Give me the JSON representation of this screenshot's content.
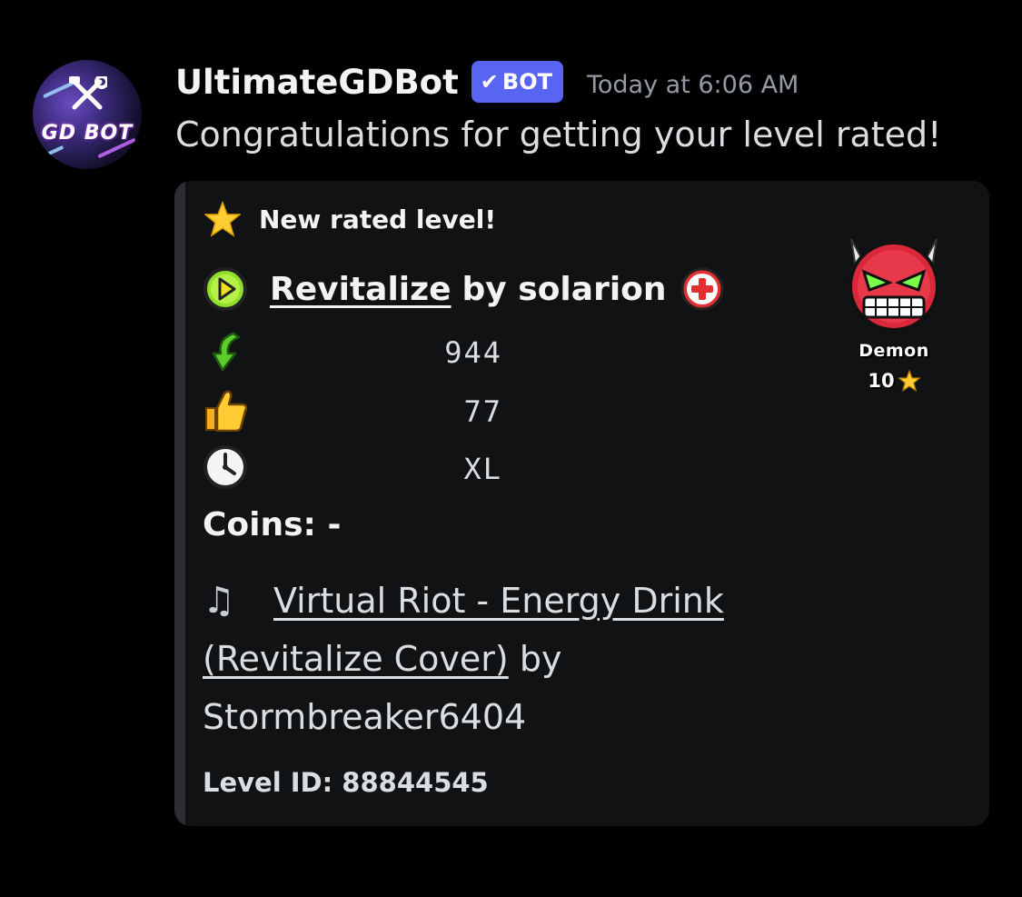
{
  "message": {
    "username": "UltimateGDBot",
    "bot_tag": "BOT",
    "timestamp": "Today at 6:06 AM",
    "text": "Congratulations for getting your level rated!",
    "avatar_text": "GD BOT"
  },
  "embed": {
    "author": "New rated level!",
    "level_name": "Revitalize",
    "by_creator": "by solarion",
    "downloads": "944",
    "likes": "77",
    "length": "XL",
    "coins": "Coins: -",
    "song_title": "Virtual Riot - Energy Drink (Revitalize Cover)",
    "song_by": "by",
    "song_artist": "Stormbreaker6404",
    "level_id": "Level ID: 88844545",
    "difficulty": "Demon",
    "stars": "10"
  },
  "icons": {
    "author": "star-icon",
    "play": "play-icon",
    "featured": "plus-icon",
    "downloads": "download-arrow-icon",
    "likes": "thumbs-up-icon",
    "length": "clock-icon",
    "song": "music-note-icon",
    "difficulty": "demon-face-icon"
  },
  "colors": {
    "bot_tag": "#5865f2",
    "embed_bg": "#111214",
    "embed_bar": "#2b2d31",
    "link": "#dbdee1"
  }
}
